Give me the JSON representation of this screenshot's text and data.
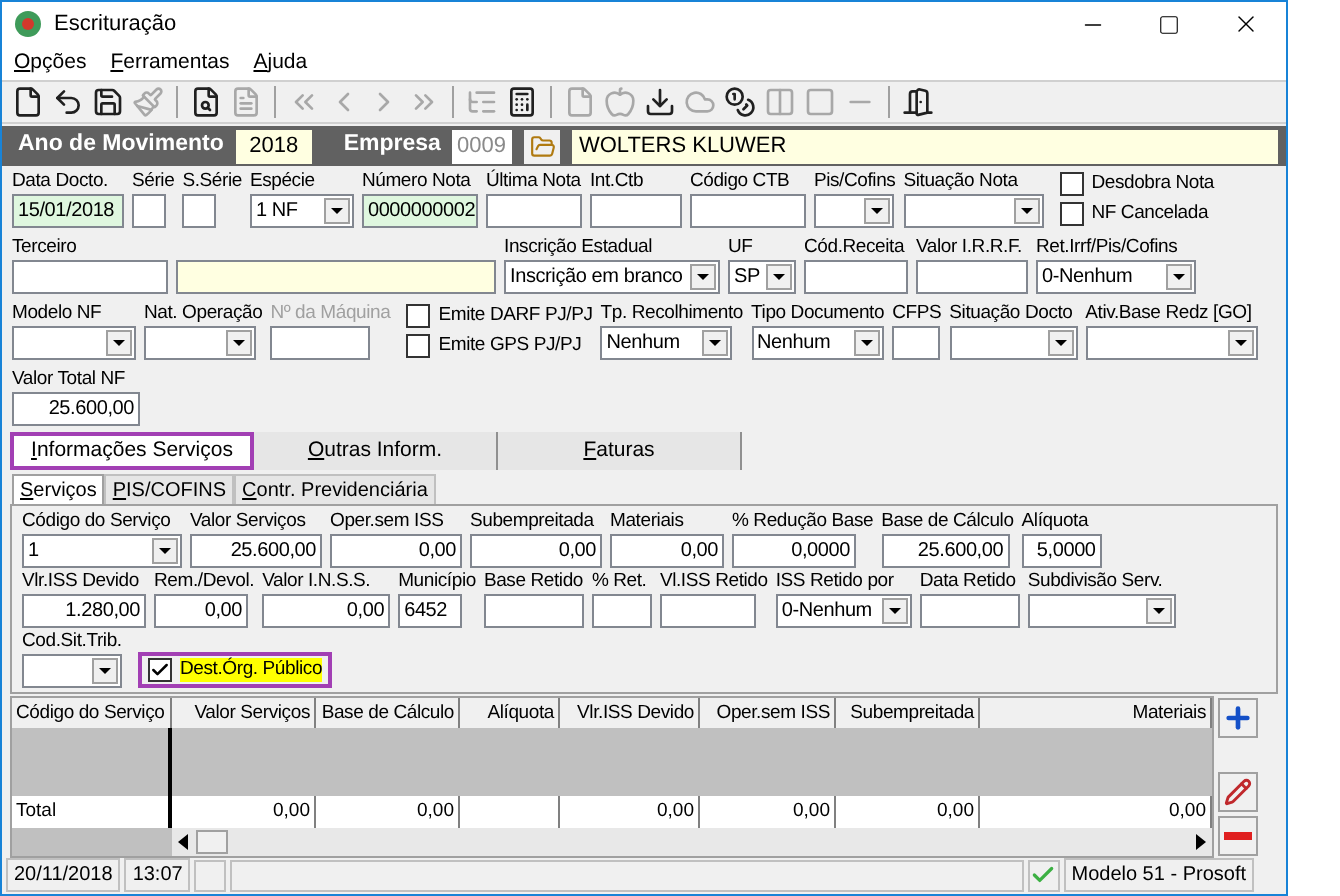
{
  "window": {
    "title": "Escrituração"
  },
  "menu": [
    {
      "label": "Opções"
    },
    {
      "label": "Ferramentas"
    },
    {
      "label": "Ajuda"
    }
  ],
  "toolbar": [
    {
      "kind": "new",
      "disabled": false
    },
    {
      "kind": "undo",
      "disabled": false
    },
    {
      "kind": "save",
      "disabled": false
    },
    {
      "kind": "brush",
      "disabled": true
    },
    {
      "kind": "separator"
    },
    {
      "kind": "preview",
      "disabled": false
    },
    {
      "kind": "nfe",
      "disabled": true
    },
    {
      "kind": "separator"
    },
    {
      "kind": "first",
      "disabled": true
    },
    {
      "kind": "prev",
      "disabled": true
    },
    {
      "kind": "next",
      "disabled": true
    },
    {
      "kind": "last",
      "disabled": true
    },
    {
      "kind": "separator"
    },
    {
      "kind": "tree",
      "disabled": true
    },
    {
      "kind": "calculator",
      "disabled": false
    },
    {
      "kind": "separator"
    },
    {
      "kind": "document",
      "disabled": true
    },
    {
      "kind": "apple",
      "disabled": true
    },
    {
      "kind": "download",
      "disabled": false
    },
    {
      "kind": "cloud",
      "disabled": true
    },
    {
      "kind": "coins",
      "disabled": false
    },
    {
      "kind": "columns",
      "disabled": true
    },
    {
      "kind": "square",
      "disabled": true
    },
    {
      "kind": "minus",
      "disabled": true
    },
    {
      "kind": "separator"
    },
    {
      "kind": "exit",
      "disabled": false
    }
  ],
  "header": {
    "year_label": "Ano de Movimento",
    "year": "2018",
    "company_label": "Empresa",
    "company_code": "0009",
    "company_name": "WOLTERS KLUWER"
  },
  "document": {
    "lines": [
      {
        "fields": [
          {
            "kind": "text",
            "label": "Data Docto.",
            "value": "15/01/2018",
            "filled": true
          },
          {
            "kind": "text",
            "label": "Série"
          },
          {
            "kind": "text",
            "label": "S.Série"
          },
          {
            "kind": "select",
            "label": "Espécie",
            "value": "1 NF"
          },
          {
            "kind": "text",
            "label": "Número Nota",
            "value": "0000000002",
            "filled": true
          },
          {
            "kind": "text",
            "label": "Última Nota"
          },
          {
            "kind": "text",
            "label": "Int.Ctb"
          },
          {
            "kind": "text",
            "label": "Código CTB"
          },
          {
            "kind": "select",
            "label": "Pis/Cofins"
          },
          {
            "kind": "select",
            "label": "Situação Nota"
          },
          {
            "kind": "checks",
            "items": [
              {
                "label": "Desdobra Nota",
                "checked": false
              },
              {
                "label": "NF Cancelada",
                "checked": false
              }
            ]
          }
        ]
      },
      {
        "fields": [
          {
            "kind": "text",
            "label": "Terceiro"
          },
          {
            "kind": "text",
            "required": true
          },
          {
            "kind": "select",
            "label": "Inscrição Estadual",
            "value": "Inscrição em branco"
          },
          {
            "kind": "select",
            "label": "UF",
            "value": "SP"
          },
          {
            "kind": "text",
            "label": "Cód.Receita"
          },
          {
            "kind": "text",
            "label": "Valor I.R.R.F."
          },
          {
            "kind": "select",
            "label": "Ret.Irrf/Pis/Cofins",
            "value": "0-Nenhum"
          }
        ]
      },
      {
        "fields": [
          {
            "kind": "select",
            "label": "Modelo NF"
          },
          {
            "kind": "select",
            "label": "Nat. Operação"
          },
          {
            "kind": "text",
            "label": "Nº da Máquina",
            "disabled": true
          },
          {
            "kind": "checks",
            "items": [
              {
                "label": "Emite DARF PJ/PJ",
                "checked": false
              },
              {
                "label": "Emite GPS PJ/PJ",
                "checked": false
              }
            ]
          },
          {
            "kind": "select",
            "label": "Tp. Recolhimento",
            "value": "Nenhum"
          },
          {
            "kind": "select",
            "label": "Tipo Documento",
            "value": "Nenhum"
          },
          {
            "kind": "text",
            "label": "CFPS"
          },
          {
            "kind": "select",
            "label": "Situação Docto"
          },
          {
            "kind": "select",
            "label": "Ativ.Base Redz [GO]"
          }
        ]
      },
      {
        "fields": [
          {
            "kind": "number",
            "label": "Valor Total NF",
            "value": "25.600,00"
          }
        ]
      }
    ]
  },
  "tabs": [
    {
      "label": "Informações Serviços",
      "selected": true,
      "highlighted": true
    },
    {
      "label": "Outras Inform.",
      "selected": false,
      "highlighted": false
    },
    {
      "label": "Faturas",
      "selected": false,
      "highlighted": false
    }
  ],
  "subtabs": [
    {
      "label": "Serviços",
      "selected": true
    },
    {
      "label": "PIS/COFINS",
      "selected": false
    },
    {
      "label": "Contr. Previdenciária",
      "selected": false
    }
  ],
  "services": {
    "lines": [
      {
        "fields": [
          {
            "kind": "select",
            "label": "Código do Serviço",
            "value": "1"
          },
          {
            "kind": "number",
            "label": "Valor Serviços",
            "value": "25.600,00"
          },
          {
            "kind": "number",
            "label": "Oper.sem ISS",
            "value": "0,00"
          },
          {
            "kind": "number",
            "label": "Subempreitada",
            "value": "0,00"
          },
          {
            "kind": "number",
            "label": "Materiais",
            "value": "0,00"
          },
          {
            "kind": "number",
            "label": "% Redução Base",
            "value": "0,0000"
          },
          {
            "kind": "number",
            "label": "Base de Cálculo",
            "value": "25.600,00"
          },
          {
            "kind": "number",
            "label": "Alíquota",
            "value": "5,0000"
          }
        ]
      },
      {
        "fields": [
          {
            "kind": "number",
            "label": "Vlr.ISS Devido",
            "value": "1.280,00"
          },
          {
            "kind": "number",
            "label": "Rem./Devol.",
            "value": "0,00"
          },
          {
            "kind": "number",
            "label": "Valor I.N.S.S.",
            "value": "0,00"
          },
          {
            "kind": "text",
            "label": "Município",
            "value": "6452"
          },
          {
            "kind": "text",
            "label": "Base Retido"
          },
          {
            "kind": "text",
            "label": "% Ret."
          },
          {
            "kind": "text",
            "label": "Vl.ISS Retido"
          },
          {
            "kind": "select",
            "label": "ISS Retido por",
            "value": "0-Nenhum"
          },
          {
            "kind": "text",
            "label": "Data Retido"
          },
          {
            "kind": "select",
            "label": "Subdivisão Serv."
          }
        ]
      },
      {
        "fields": [
          {
            "kind": "select",
            "label": "Cod.Sit.Trib."
          },
          {
            "kind": "check",
            "label": "Dest.Órg. Público",
            "checked": true,
            "highlighted": true
          }
        ]
      }
    ]
  },
  "grid": {
    "columns": [
      "Código do Serviço",
      "Valor Serviços",
      "Base de Cálculo",
      "Alíquota",
      "Vlr.ISS Devido",
      "Oper.sem ISS",
      "Subempreitada",
      "Materiais"
    ],
    "total_row": [
      {
        "kind": "value",
        "value": "Total"
      },
      {
        "kind": "value",
        "value": "0,00"
      },
      {
        "kind": "value",
        "value": "0,00"
      },
      {
        "kind": "blank"
      },
      {
        "kind": "value",
        "value": "0,00"
      },
      {
        "kind": "value",
        "value": "0,00"
      },
      {
        "kind": "value",
        "value": "0,00"
      },
      {
        "kind": "value",
        "value": "0,00"
      }
    ]
  },
  "status_bar": {
    "date": "20/11/2018",
    "time": "13:07",
    "model": "Modelo 51 - Prosoft"
  }
}
